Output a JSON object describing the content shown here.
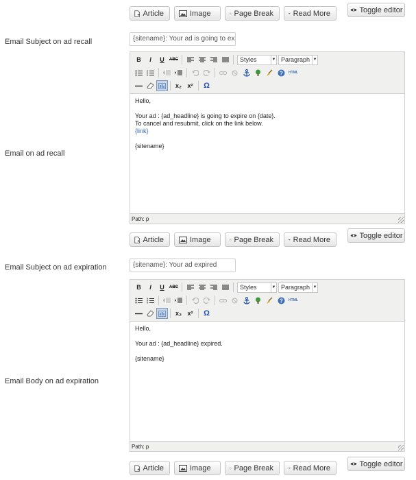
{
  "buttons": {
    "article": "Article",
    "image": "Image",
    "page_break": "Page Break",
    "read_more": "Read More",
    "toggle_editor": "Toggle editor"
  },
  "fields": {
    "recall_subject": {
      "label": "Email Subject on ad recall",
      "value": "{sitename}: Your ad is going to expir"
    },
    "recall_email": {
      "label": "Email on ad recall",
      "content": {
        "line1": "Hello,",
        "line2": "Your ad : {ad_headline} is going to expire on {date}.",
        "line3": "To cancel and resubmit, click on the link below.",
        "line4": "{link}",
        "line5": "{sitename}"
      },
      "path": "Path: p"
    },
    "expiration_subject": {
      "label": "Email Subject on ad expiration",
      "value": "{sitename}: Your ad expired"
    },
    "expiration_body": {
      "label": "Email Body on ad expiration",
      "content": {
        "line1": "Hello,",
        "line2": "Your ad : {ad_headline} expired.",
        "line3": "{sitename}"
      },
      "path": "Path: p"
    }
  },
  "toolbar": {
    "styles": "Styles",
    "format": "Paragraph",
    "bold": "B",
    "italic": "I",
    "underline": "U",
    "strike": "ABC",
    "subscript": "x₂",
    "superscript": "x²",
    "charmap": "Ω",
    "html": "HTML"
  },
  "colors": {
    "link": "#3366aa",
    "help_icon": "#3f6fb5",
    "anchor_icon": "#2255aa"
  }
}
